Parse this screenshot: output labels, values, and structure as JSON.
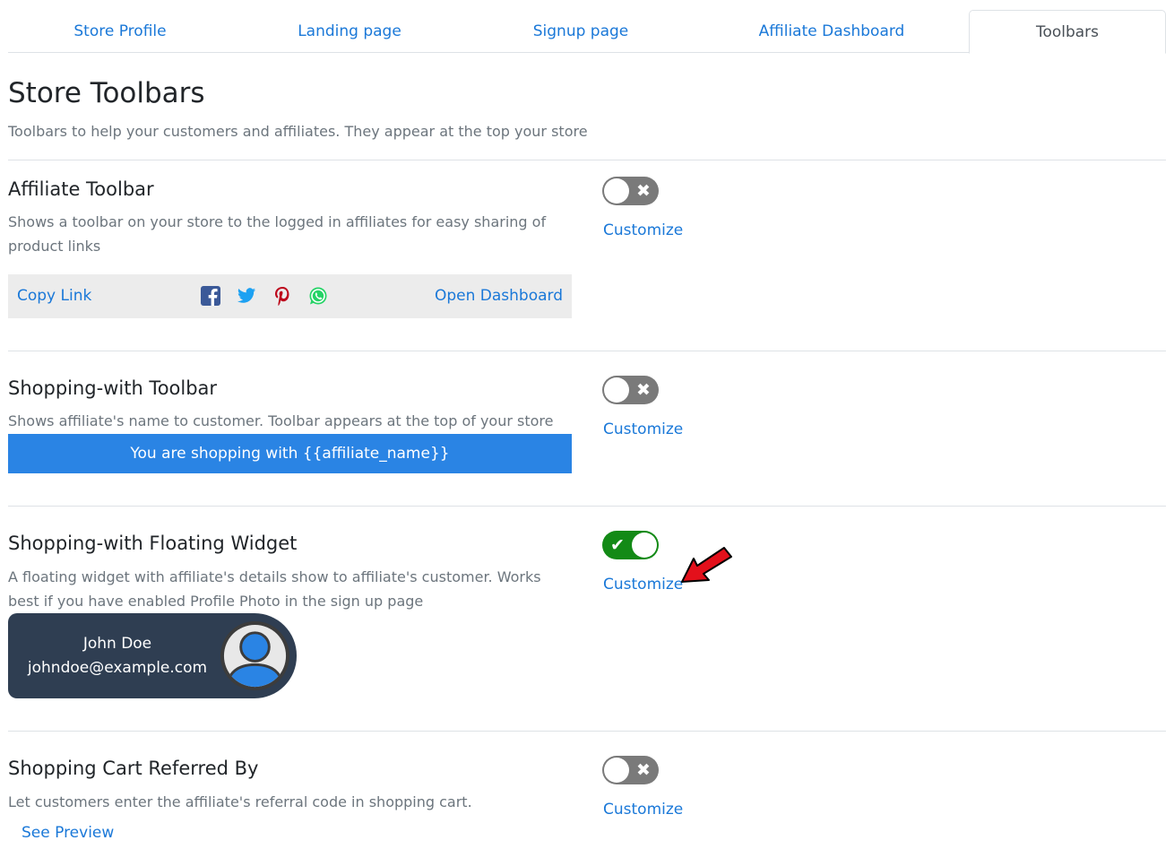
{
  "tabs": [
    {
      "label": "Store Profile"
    },
    {
      "label": "Landing page"
    },
    {
      "label": "Signup page"
    },
    {
      "label": "Affiliate Dashboard"
    },
    {
      "label": "Toolbars",
      "active": true
    }
  ],
  "page": {
    "title": "Store Toolbars",
    "subtitle": "Toolbars to help your customers and affiliates. They appear at the top your store"
  },
  "sections": {
    "affiliate_toolbar": {
      "title": "Affiliate Toolbar",
      "description": "Shows a toolbar on your store to the logged in affiliates for easy sharing of product links",
      "enabled": false,
      "customize_label": "Customize",
      "preview": {
        "copy_link_label": "Copy Link",
        "open_dashboard_label": "Open Dashboard",
        "share_icons": [
          "facebook-icon",
          "twitter-icon",
          "pinterest-icon",
          "whatsapp-icon"
        ]
      }
    },
    "shopping_with_toolbar": {
      "title": "Shopping-with Toolbar",
      "description": "Shows affiliate's name to customer. Toolbar appears at the top of your store",
      "enabled": false,
      "customize_label": "Customize",
      "preview_text": "You are shopping with {{affiliate_name}}"
    },
    "floating_widget": {
      "title": "Shopping-with Floating Widget",
      "description": "A floating widget with affiliate's details show to affiliate's customer. Works best if you have enabled Profile Photo in the sign up page",
      "enabled": true,
      "customize_label": "Customize",
      "preview": {
        "name": "John Doe",
        "email": "johndoe@example.com"
      }
    },
    "cart_referred_by": {
      "title": "Shopping Cart Referred By",
      "description": "Let customers enter the affiliate's referral code in shopping cart.",
      "enabled": false,
      "customize_label": "Customize",
      "see_preview_label": "See Preview"
    }
  },
  "colors": {
    "link": "#1a78d8",
    "toggle_off": "#7a7a7a",
    "toggle_on": "#138a16",
    "shop_bar": "#2a84e4",
    "widget_bg": "#2f3e52",
    "annotation_arrow": "#e3101b"
  }
}
